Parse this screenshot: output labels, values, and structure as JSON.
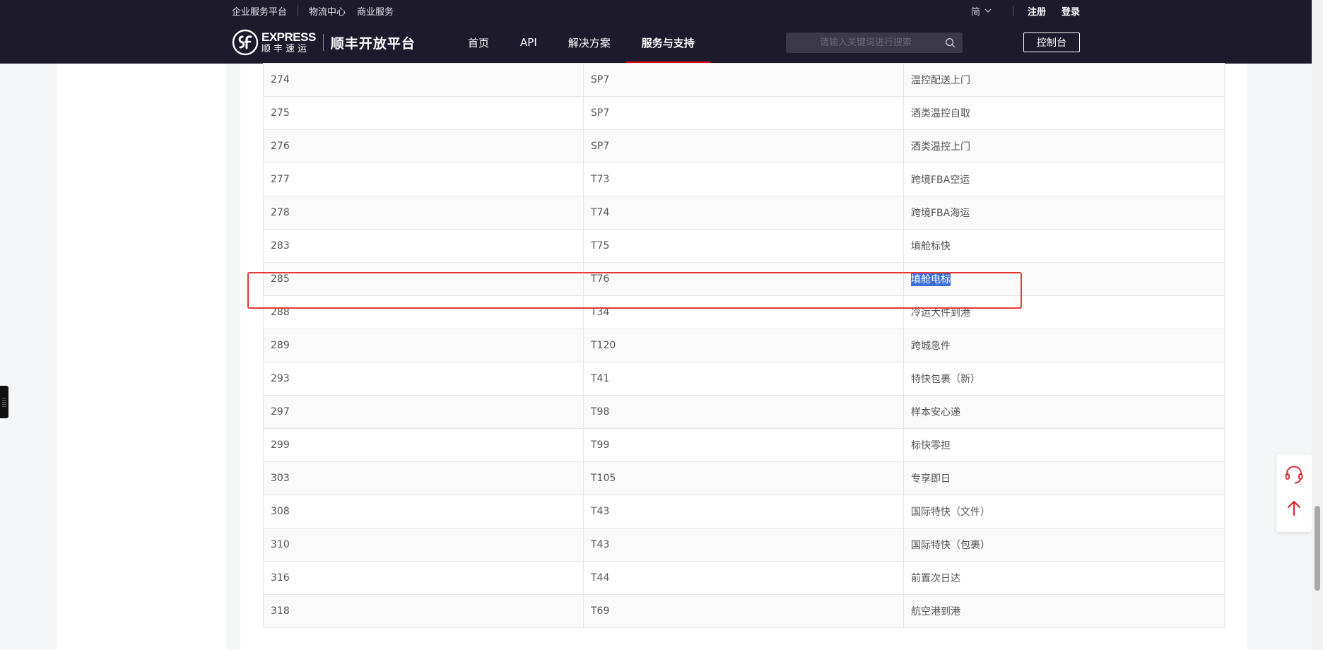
{
  "utility_bar": {
    "left_links": [
      "企业服务平台",
      "物流中心",
      "商业服务"
    ],
    "language": "简",
    "register": "注册",
    "login": "登录"
  },
  "nav": {
    "logo_en": "EXPRESS",
    "logo_cn": "顺丰速运",
    "platform_name": "顺丰开放平台",
    "items": [
      {
        "label": "首页",
        "active": false
      },
      {
        "label": "API",
        "active": false
      },
      {
        "label": "解决方案",
        "active": false
      },
      {
        "label": "服务与支持",
        "active": true
      }
    ],
    "search_placeholder": "请输入关键词进行搜索",
    "console_label": "控制台"
  },
  "table": {
    "rows": [
      {
        "code": "274",
        "product": "SP7",
        "name": "温控配送上门"
      },
      {
        "code": "275",
        "product": "SP7",
        "name": "酒类温控自取"
      },
      {
        "code": "276",
        "product": "SP7",
        "name": "酒类温控上门"
      },
      {
        "code": "277",
        "product": "T73",
        "name": "跨境FBA空运"
      },
      {
        "code": "278",
        "product": "T74",
        "name": "跨境FBA海运"
      },
      {
        "code": "283",
        "product": "T75",
        "name": "填舱标快"
      },
      {
        "code": "285",
        "product": "T76",
        "name": "填舱电标"
      },
      {
        "code": "288",
        "product": "T34",
        "name": "冷运大件到港"
      },
      {
        "code": "289",
        "product": "T120",
        "name": "跨城急件"
      },
      {
        "code": "293",
        "product": "T41",
        "name": "特快包裹（新）"
      },
      {
        "code": "297",
        "product": "T98",
        "name": "样本安心递"
      },
      {
        "code": "299",
        "product": "T99",
        "name": "标快零担"
      },
      {
        "code": "303",
        "product": "T105",
        "name": "专享即日"
      },
      {
        "code": "308",
        "product": "T43",
        "name": "国际特快（文件）"
      },
      {
        "code": "310",
        "product": "T43",
        "name": "国际特快（包裹）"
      },
      {
        "code": "316",
        "product": "T44",
        "name": "前置次日达"
      },
      {
        "code": "318",
        "product": "T69",
        "name": "航空港到港"
      }
    ],
    "highlighted_row_index": 6
  },
  "colors": {
    "header_bg": "#1d1a2b",
    "accent_red": "#e1061a",
    "highlight_border": "#e53935",
    "selection_bg": "#3a6fd6"
  },
  "icons": {
    "customer_service": "headset-icon",
    "back_to_top": "arrow-up-icon",
    "search": "search-icon",
    "language_dropdown": "chevron-down-icon"
  }
}
